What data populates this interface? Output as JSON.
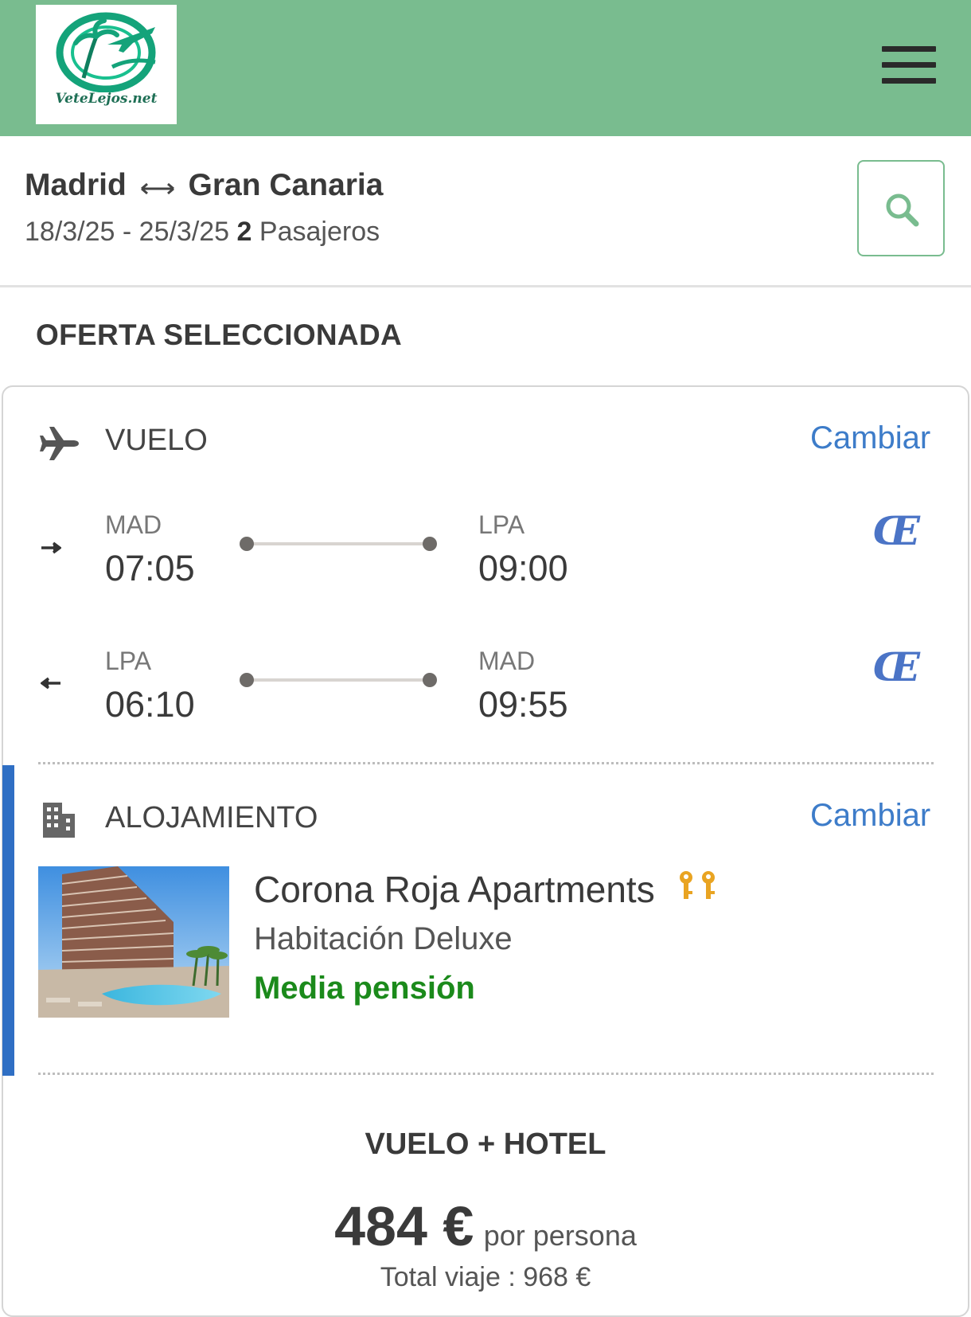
{
  "header": {
    "logo_text": "VeteLejos.net",
    "menu_icon": "hamburger-menu-icon",
    "background_color": "#79bc8f"
  },
  "search": {
    "origin": "Madrid",
    "destination": "Gran Canaria",
    "dates": "18/3/25 - 25/3/25",
    "passengers_count": "2",
    "passengers_label": "Pasajeros",
    "search_icon": "search-icon"
  },
  "offer": {
    "section_title": "OFERTA SELECCIONADA",
    "flight": {
      "label": "VUELO",
      "change_label": "Cambiar",
      "icon": "airplane-icon",
      "segments": [
        {
          "direction_icon": "arrow-right-icon",
          "from_code": "MAD",
          "from_time": "07:05",
          "to_code": "LPA",
          "to_time": "09:00",
          "airline_icon": "air-europa-logo-icon"
        },
        {
          "direction_icon": "arrow-left-icon",
          "from_code": "LPA",
          "from_time": "06:10",
          "to_code": "MAD",
          "to_time": "09:55",
          "airline_icon": "air-europa-logo-icon"
        }
      ]
    },
    "accommodation": {
      "label": "ALOJAMIENTO",
      "change_label": "Cambiar",
      "icon": "building-icon",
      "hotel_name": "Corona Roja Apartments",
      "keys_rating": 2,
      "room": "Habitación Deluxe",
      "board": "Media pensión"
    },
    "price": {
      "title": "VUELO + HOTEL",
      "amount": "484 €",
      "per_person": "por persona",
      "total": "Total viaje : 968 €"
    }
  },
  "colors": {
    "accent_green": "#79bc8f",
    "link_blue": "#3d7cc9",
    "board_green": "#1b8a1b",
    "selected_bar": "#2f6fc4"
  }
}
